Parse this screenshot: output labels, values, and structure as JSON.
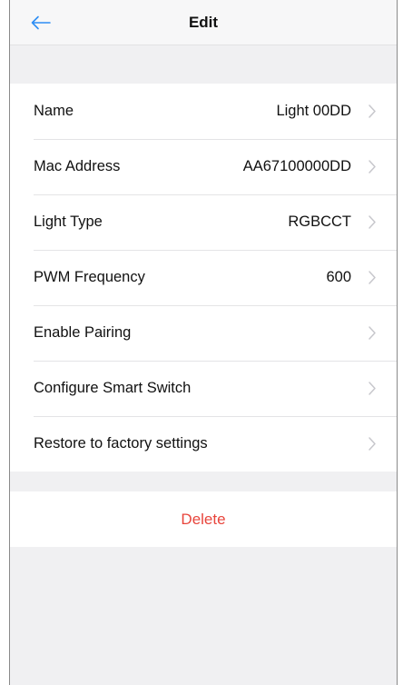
{
  "header": {
    "title": "Edit",
    "back_icon": "arrow-left-icon",
    "accent_color": "#2f8ef4"
  },
  "settings": {
    "items": [
      {
        "label": "Name",
        "value": "Light 00DD"
      },
      {
        "label": "Mac Address",
        "value": "AA67100000DD"
      },
      {
        "label": "Light Type",
        "value": "RGBCCT"
      },
      {
        "label": "PWM Frequency",
        "value": "600"
      },
      {
        "label": "Enable Pairing",
        "value": ""
      },
      {
        "label": "Configure Smart Switch",
        "value": ""
      },
      {
        "label": "Restore to factory settings",
        "value": ""
      }
    ],
    "chevron_icon": "chevron-right-icon"
  },
  "actions": {
    "delete_label": "Delete",
    "delete_color": "#e8453c"
  }
}
